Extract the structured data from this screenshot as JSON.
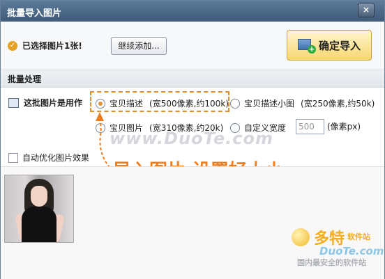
{
  "dialog": {
    "title": "批量导入图片",
    "close_icon": "×"
  },
  "top": {
    "selected_text": "已选择图片1张!",
    "continue_button": "继续添加...",
    "confirm_button": "确定导入"
  },
  "batch": {
    "section_title": "批量处理",
    "usage_label": "这批图片是用作",
    "options": [
      {
        "label": "宝贝描述",
        "detail": "(宽500像素,约100k)",
        "selected": true
      },
      {
        "label": "宝贝描述小图",
        "detail": "(宽250像素,约50k)",
        "selected": false
      },
      {
        "label": "宝贝图片",
        "detail": "(宽310像素,约20k)",
        "selected": false
      },
      {
        "label": "自定义宽度",
        "detail": "",
        "selected": false
      }
    ],
    "custom_width_value": "500",
    "custom_width_unit": "(像素px)",
    "auto_optimize_label": "自动优化图片效果"
  },
  "annotation": {
    "text": "导入图片,设置好大小",
    "color": "#ef7c1d"
  },
  "watermarks": {
    "url": "www.DuoTe.com",
    "brand": "多特",
    "brand_suffix": "软件站",
    "domain": "DuoTe.com",
    "slogan": "国内最安全的软件站"
  },
  "icons": {
    "check": "check-circle-icon",
    "confirm": "image-add-icon",
    "usage": "image-icon"
  }
}
